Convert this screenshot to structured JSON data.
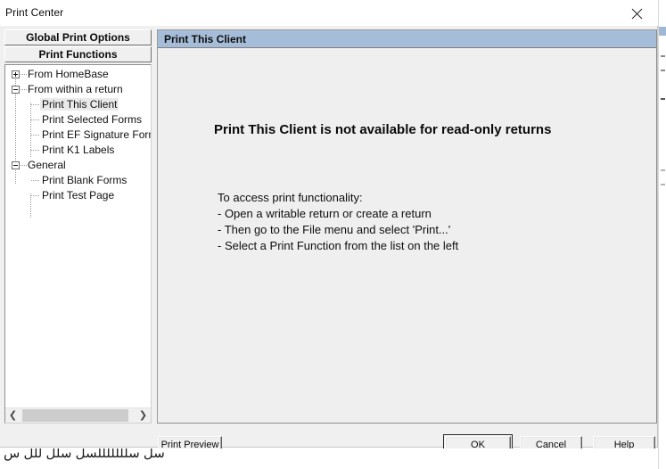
{
  "window": {
    "title": "Print Center",
    "close_icon": "close-icon"
  },
  "left_panel": {
    "header_buttons": [
      {
        "label": "Global Print Options"
      },
      {
        "label": "Print Functions"
      }
    ],
    "tree": [
      {
        "label": "From HomeBase",
        "level": 0,
        "expander": "plus",
        "selected": false
      },
      {
        "label": "From within a return",
        "level": 0,
        "expander": "minus",
        "selected": false
      },
      {
        "label": "Print This Client",
        "level": 1,
        "expander": "none",
        "selected": true
      },
      {
        "label": "Print Selected Forms",
        "level": 1,
        "expander": "none",
        "selected": false
      },
      {
        "label": "Print EF Signature Forms",
        "level": 1,
        "expander": "none",
        "selected": false
      },
      {
        "label": "Print K1 Labels",
        "level": 1,
        "expander": "none",
        "selected": false
      },
      {
        "label": "General",
        "level": 0,
        "expander": "minus",
        "selected": false
      },
      {
        "label": "Print Blank Forms",
        "level": 1,
        "expander": "none",
        "selected": false
      },
      {
        "label": "Print Test Page",
        "level": 1,
        "expander": "none",
        "selected": false
      }
    ],
    "scrollbar": {
      "left_arrow": "❮",
      "right_arrow": "❯"
    }
  },
  "content": {
    "header_title": "Print This Client",
    "headline": "Print This Client is not available for read-only returns",
    "body_lines": [
      "To access print functionality:",
      "- Open a writable return or create a return",
      "- Then go to the File menu and select 'Print...'",
      "- Select a Print Function from the list on the left"
    ]
  },
  "buttons": {
    "print_preview": "Print Preview",
    "ok": "OK",
    "cancel": "Cancel",
    "help": "Help"
  },
  "background": {
    "bottom_text": "سل سلللللللسل   سلل للل س"
  },
  "colors": {
    "panel_header": "#a5bdd8",
    "dialog_face": "#f0f0f0",
    "content_face": "#efefef",
    "selection": "#eaeaea"
  }
}
